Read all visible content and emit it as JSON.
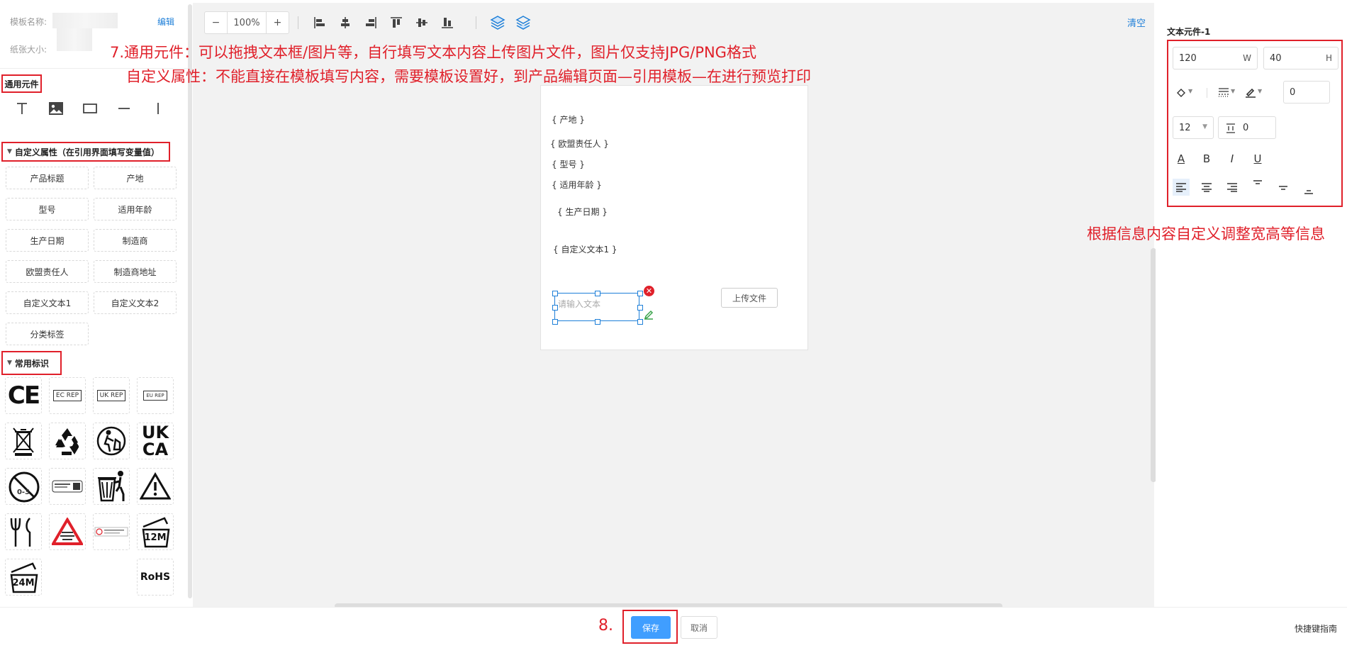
{
  "left": {
    "template_name_label": "模板名称:",
    "edit_link": "编辑",
    "paper_size_label": "纸张大小:",
    "general_title": "通用元件",
    "custom_title": "自定义属性（在引用界面填写变量值）",
    "custom_attrs": [
      "产品标题",
      "产地",
      "型号",
      "适用年龄",
      "生产日期",
      "制造商",
      "欧盟责任人",
      "制造商地址",
      "自定义文本1",
      "自定义文本2",
      "分类标签"
    ],
    "common_title": "常用标识",
    "symbols": {
      "ce": "CE",
      "ec_rep": "EC REP",
      "uk_rep": "UK REP",
      "eu_rep": "EU REP",
      "ukca_1": "UK",
      "ukca_2": "CA",
      "age": "0-3",
      "m12": "12M",
      "m24": "24M",
      "rohs": "RoHS"
    }
  },
  "toolbar": {
    "zoom_minus": "−",
    "zoom_value": "100%",
    "zoom_plus": "+",
    "clear_link": "清空"
  },
  "canvas": {
    "fields": [
      "{ 产地 }",
      "{ 欧盟责任人 }",
      "{ 型号 }",
      "{ 适用年龄 }",
      "{ 生产日期 }",
      "{ 自定义文本1 }"
    ],
    "text_placeholder": "请输入文本",
    "delete_glyph": "✕",
    "upload_label": "上传文件"
  },
  "right": {
    "title": "文本元件-1",
    "width_value": "120",
    "width_unit": "W",
    "height_value": "40",
    "height_unit": "H",
    "border_value": "0",
    "font_size": "12",
    "line_spacing": "0",
    "text_color_glyph": "A",
    "bold_glyph": "B",
    "italic_glyph": "I",
    "underline_glyph": "U"
  },
  "bottom": {
    "save_label": "保存",
    "cancel_label": "取消",
    "shortcut_label": "快捷键指南"
  },
  "annotations": {
    "line1": "7.通用元件：可以拖拽文本框/图片等，自行填写文本内容上传图片文件，图片仅支持JPG/PNG格式",
    "line2": "自定义属性：不能直接在模板填写内容，需要模板设置好，到产品编辑页面—引用模板—在进行预览打印",
    "right_note": "根据信息内容自定义调整宽高等信息",
    "step8": "8."
  },
  "colors": {
    "accent": "#409eff",
    "link": "#1e7fd8",
    "annotation_red": "#e0202a"
  }
}
